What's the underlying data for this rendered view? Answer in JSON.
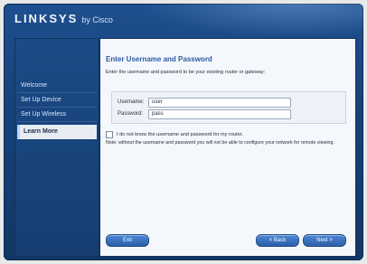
{
  "header": {
    "brand": "LINKSYS",
    "by": "by Cisco"
  },
  "sidebar": {
    "items": [
      {
        "label": "Welcome"
      },
      {
        "label": "Set Up Device"
      },
      {
        "label": "Set Up Wireless"
      },
      {
        "label": "Learn More"
      }
    ]
  },
  "main": {
    "title": "Enter Username and Password",
    "instruction": "Enter the username and password to be your existing router or gateway:",
    "username_label": "Username:",
    "username_value": "user",
    "password_label": "Password:",
    "password_value": "pass",
    "checkbox_label": "I do not know the username and password for my router.",
    "note": "Note: without the username and password you will not be able to configure your network for remote viewing."
  },
  "buttons": {
    "exit": "Exit",
    "back": "< Back",
    "next": "Next >"
  }
}
